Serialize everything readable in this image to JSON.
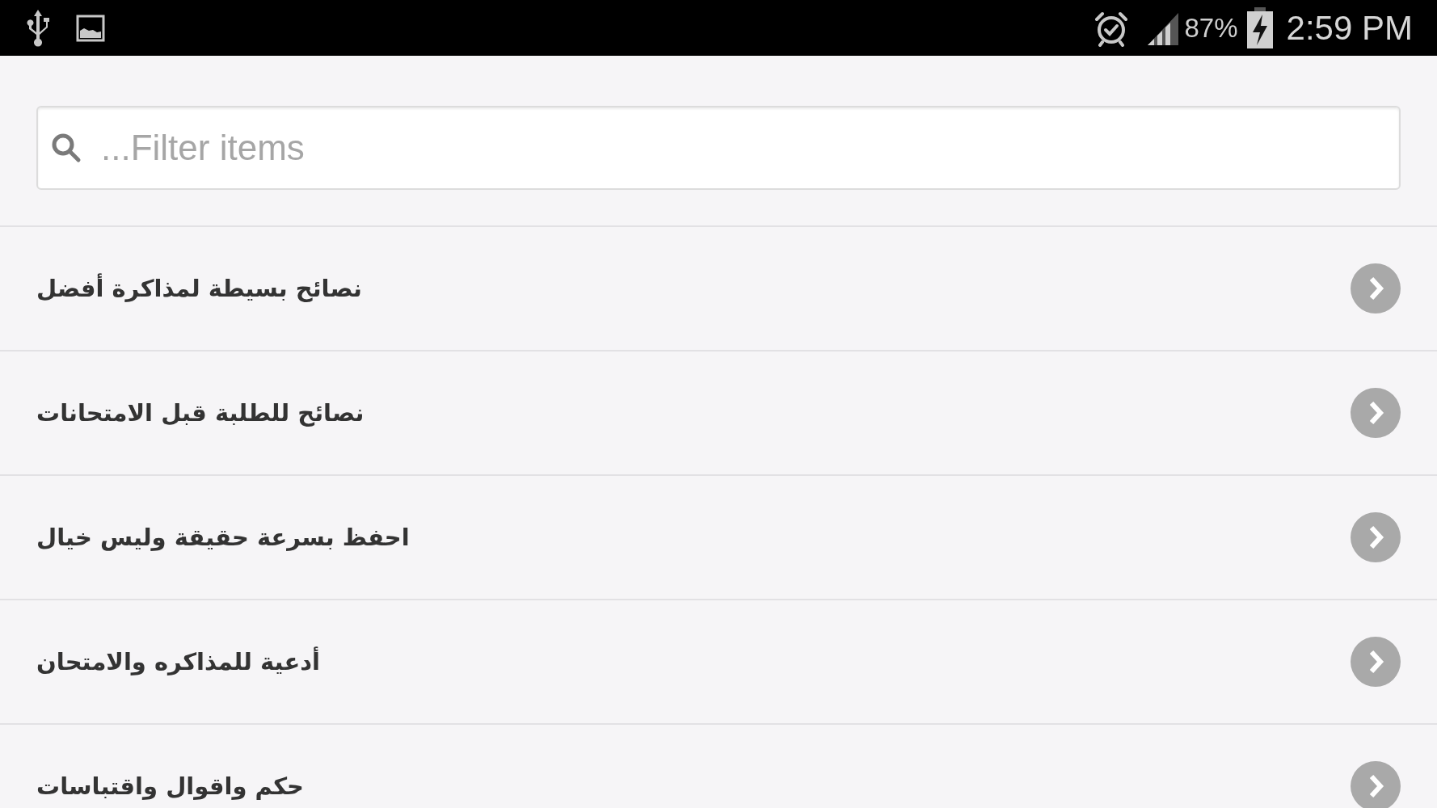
{
  "status_bar": {
    "battery": "87%",
    "time": "2:59 PM"
  },
  "search": {
    "placeholder": "...Filter items"
  },
  "items": [
    {
      "label": "نصائح بسيطة لمذاكرة أفضل"
    },
    {
      "label": "نصائح للطلبة قبل الامتحانات"
    },
    {
      "label": "احفظ بسرعة حقيقة وليس خيال"
    },
    {
      "label": "أدعية للمذاكره والامتحان"
    },
    {
      "label": "حكم واقوال واقتباسات"
    }
  ]
}
